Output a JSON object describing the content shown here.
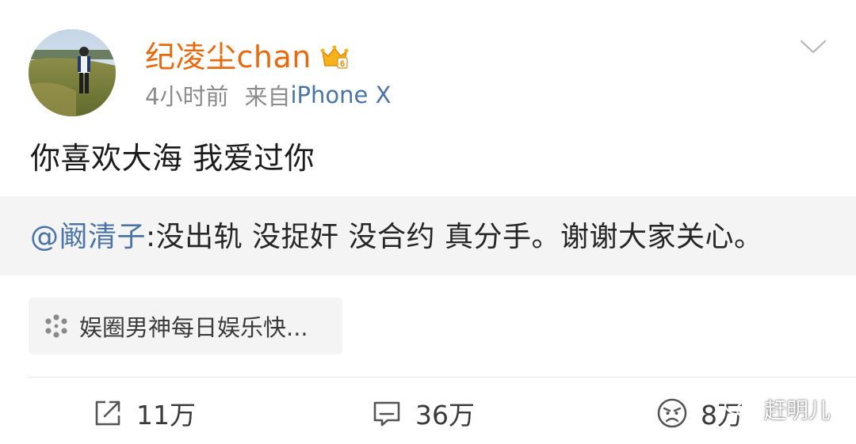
{
  "post": {
    "username": "纪凌尘chan",
    "time": "4小时前",
    "source_prefix": "来自",
    "source_device": "iPhone X",
    "text": "你喜欢大海 我爱过你"
  },
  "repost": {
    "mention": "@阚清子",
    "text": ":没出轨 没捉奸 没合约 真分手。谢谢大家关心。"
  },
  "topic": {
    "label": "娱圈男神每日娱乐快...",
    "icon": "topic-dots-icon"
  },
  "actions": {
    "repost_count": "11万",
    "comment_count": "36万",
    "like_count": "8万"
  },
  "watermark": {
    "text": "赶明儿",
    "icon": "wechat-icon"
  },
  "colors": {
    "username": "#e8690e",
    "link": "#4b74a6",
    "meta": "#8c8c8c",
    "repost_bg": "#f4f4f4"
  }
}
